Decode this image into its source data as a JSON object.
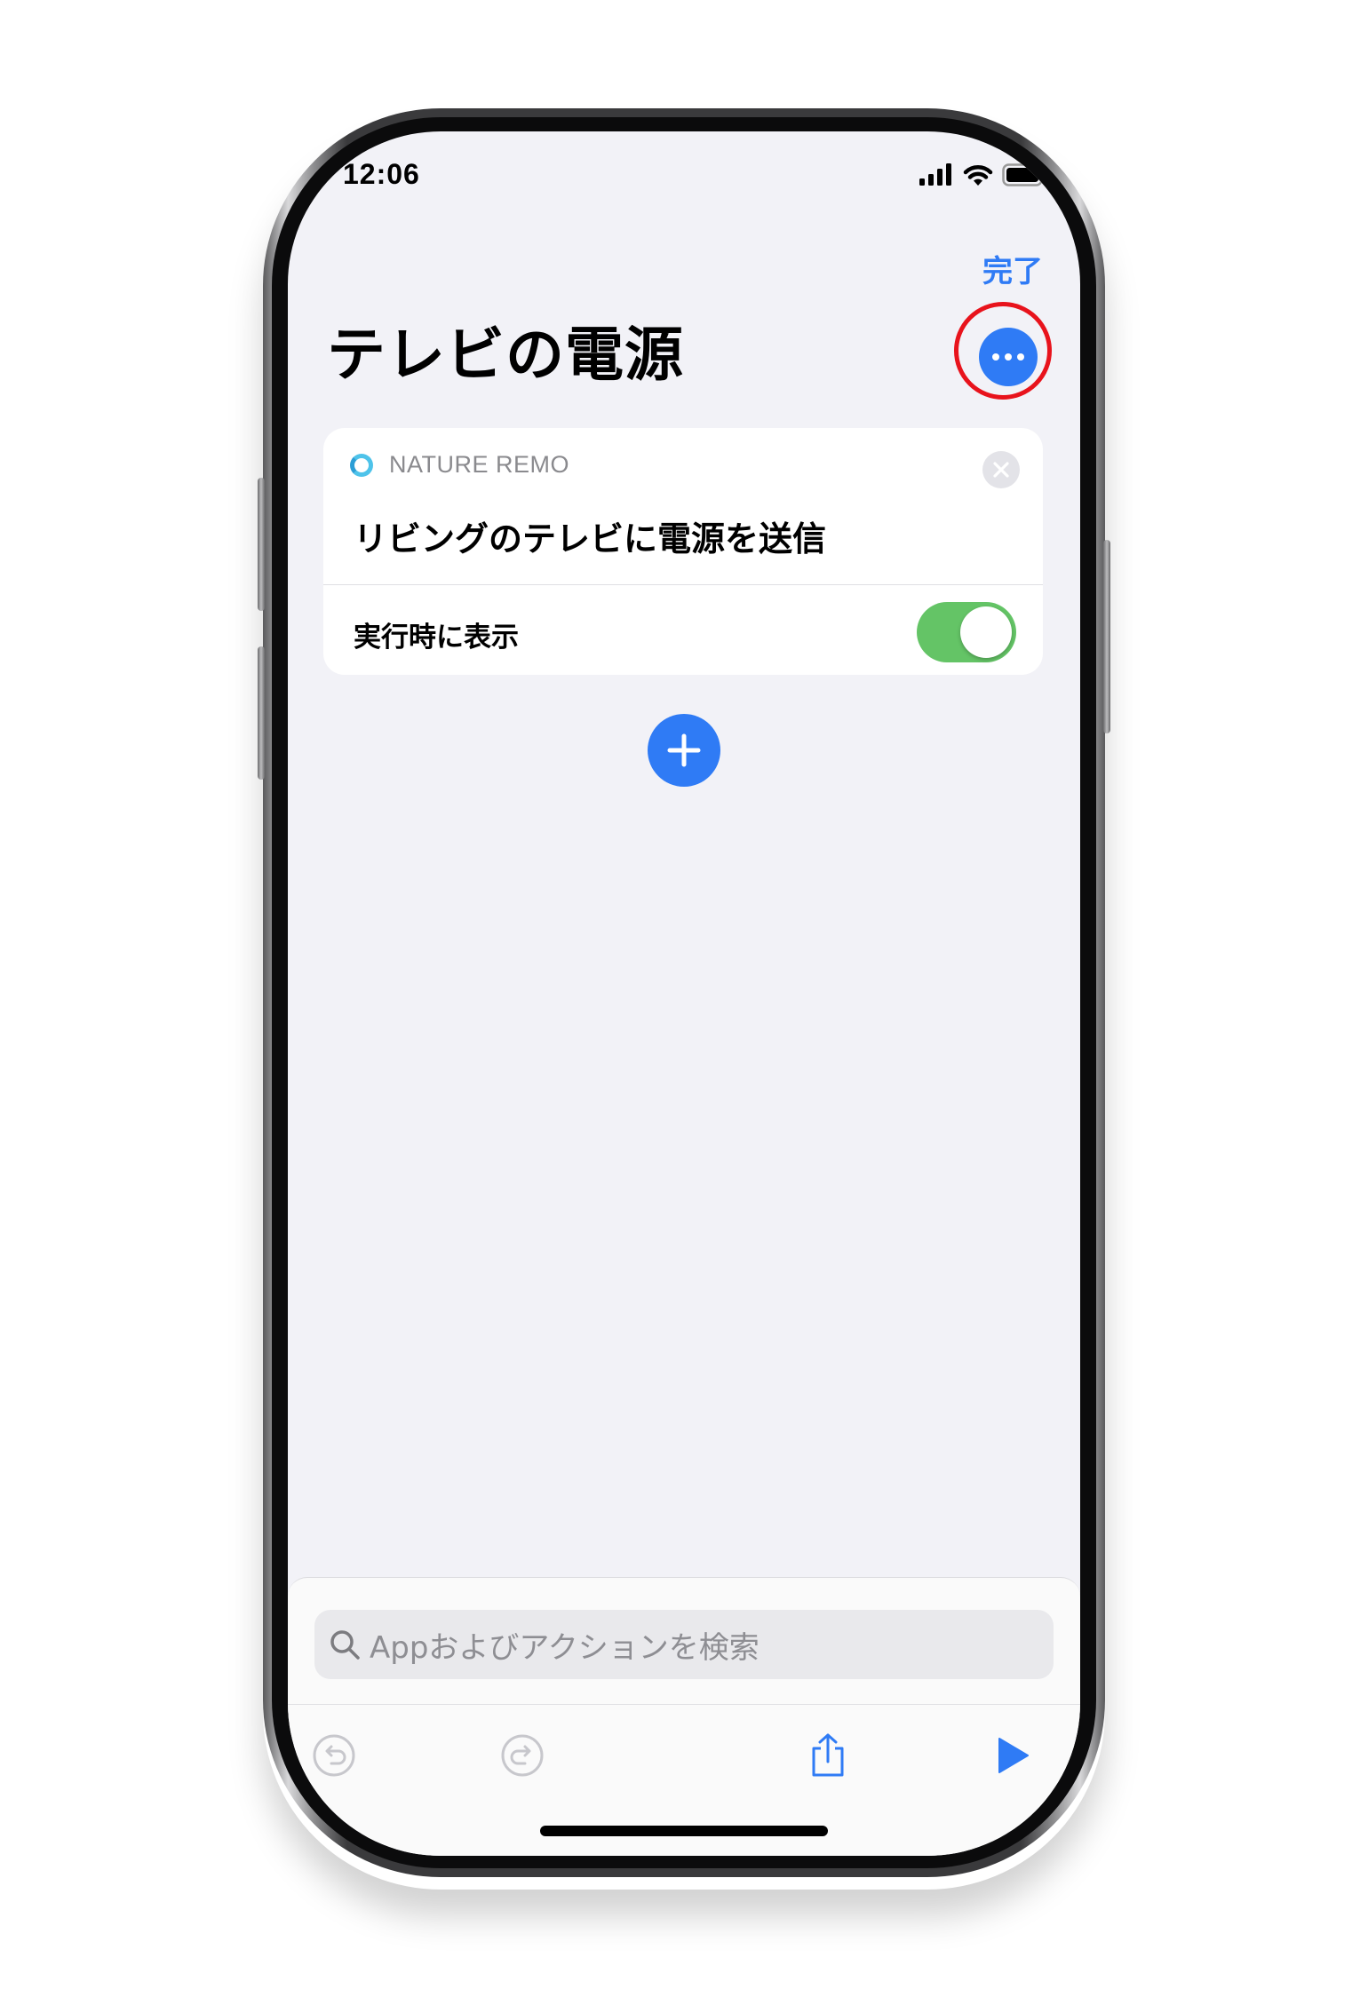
{
  "status_bar": {
    "time": "12:06"
  },
  "nav": {
    "done_label": "完了"
  },
  "shortcut": {
    "title": "テレビの電源"
  },
  "action_card": {
    "app_name": "NATURE REMO",
    "action_text": "リビングのテレビに電源を送信",
    "setting_label": "実行時に表示",
    "show_when_run": true
  },
  "search": {
    "placeholder": "Appおよびアクションを検索"
  },
  "colors": {
    "accent": "#2f7bf5",
    "toggle_on": "#64c466",
    "highlight_ring": "#e8131c"
  },
  "icons": {
    "more": "ellipsis-icon",
    "add": "plus-icon",
    "close": "close-icon",
    "undo": "undo-icon",
    "redo": "redo-icon",
    "share": "share-icon",
    "play": "play-icon"
  }
}
